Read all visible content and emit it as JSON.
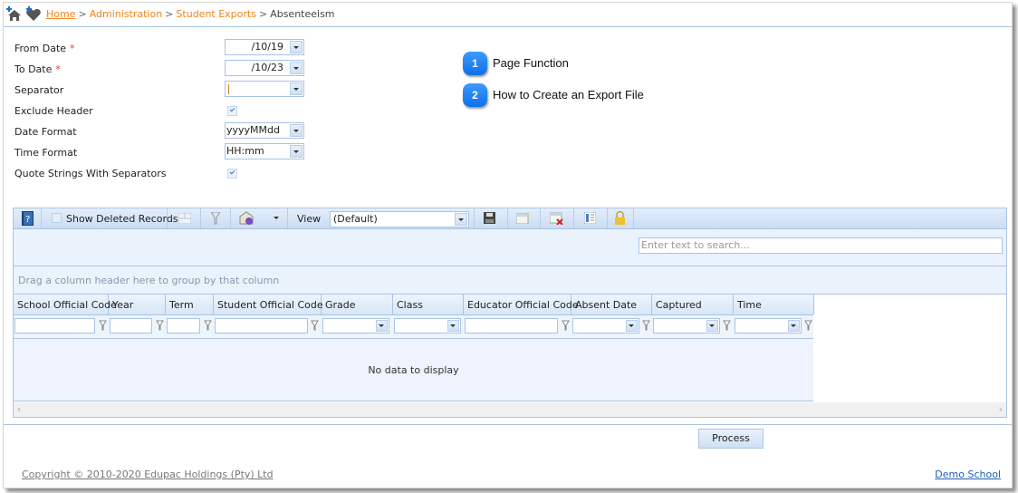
{
  "breadcrumb": {
    "items": [
      "Home",
      "Administration",
      "Student Exports"
    ],
    "current": "Absenteeism",
    "separator": ">"
  },
  "form": {
    "from_date": {
      "label": "From Date",
      "required_mark": "*",
      "value": "/10/19"
    },
    "to_date": {
      "label": "To Date",
      "required_mark": "*",
      "value": "/10/23"
    },
    "separator": {
      "label": "Separator",
      "value": "|"
    },
    "exclude_header": {
      "label": "Exclude Header",
      "checked": true
    },
    "date_format": {
      "label": "Date Format",
      "value": "yyyyMMdd"
    },
    "time_format": {
      "label": "Time Format",
      "value": "HH:mm"
    },
    "quote_strings": {
      "label": "Quote Strings With Separators",
      "checked": true
    }
  },
  "help": [
    {
      "number": "1",
      "label": "Page Function"
    },
    {
      "number": "2",
      "label": "How to Create an Export File"
    }
  ],
  "toolbar": {
    "show_deleted_label": "Show Deleted Records",
    "view_label": "View",
    "view_value": "(Default)"
  },
  "grid": {
    "search_placeholder": "Enter text to search...",
    "group_hint": "Drag a column header here to group by that column",
    "columns": [
      "School Official Code",
      "Year",
      "Term",
      "Student Official Code",
      "Grade",
      "Class",
      "Educator Official Code",
      "Absent Date",
      "Captured",
      "Time"
    ],
    "empty_text": "No data to display"
  },
  "footer": {
    "process_label": "Process",
    "copyright": "Copyright © 2010-2020 Edupac Holdings (Pty) Ltd",
    "school": "Demo School"
  }
}
